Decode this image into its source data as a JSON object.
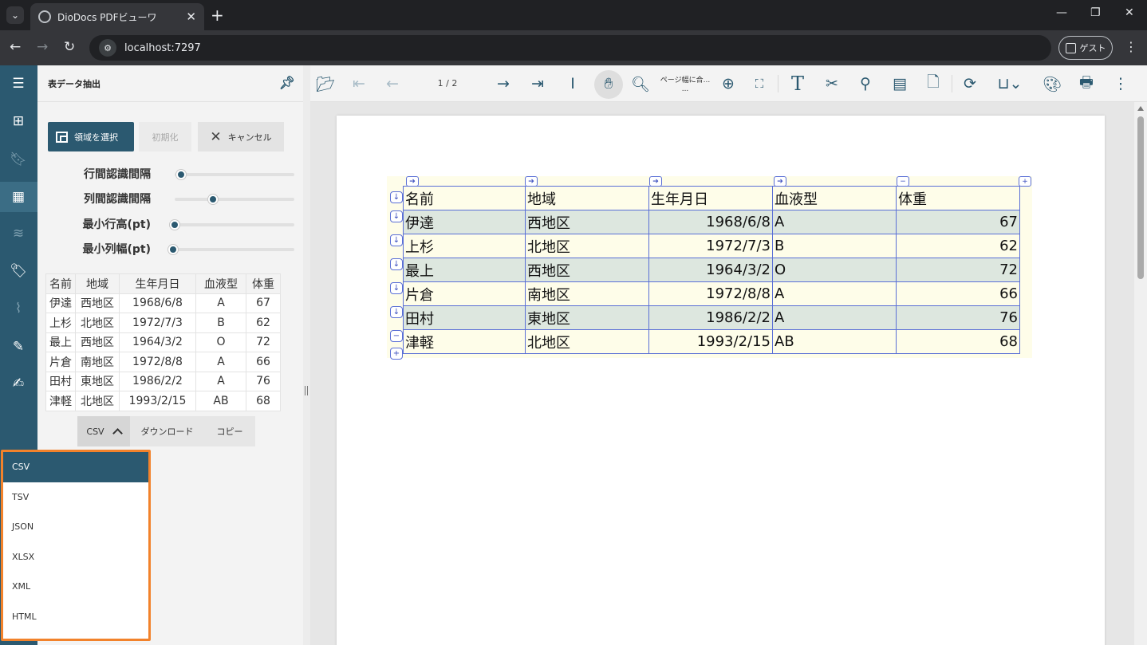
{
  "browser": {
    "tab_title": "DioDocs PDFビューワ",
    "tab_close": "✕",
    "new_tab": "+",
    "url": "localhost:7297",
    "guest_label": "ゲスト"
  },
  "panel": {
    "title": "表データ抽出",
    "select_area_label": "領域を選択",
    "reset_label": "初期化",
    "cancel_label": "キャンセル",
    "sliders": [
      {
        "label": "行間認識間隔",
        "level": 0.07
      },
      {
        "label": "列間認識間隔",
        "level": 0.34
      },
      {
        "label": "最小行高(pt)",
        "level": 0.0
      },
      {
        "label": "最小列幅(pt)",
        "level": 0.0
      }
    ],
    "table": {
      "headers": [
        "名前",
        "地域",
        "生年月日",
        "血液型",
        "体重"
      ],
      "rows": [
        [
          "伊達",
          "西地区",
          "1968/6/8",
          "A",
          "67"
        ],
        [
          "上杉",
          "北地区",
          "1972/7/3",
          "B",
          "62"
        ],
        [
          "最上",
          "西地区",
          "1964/3/2",
          "O",
          "72"
        ],
        [
          "片倉",
          "南地区",
          "1972/8/8",
          "A",
          "66"
        ],
        [
          "田村",
          "東地区",
          "1986/2/2",
          "A",
          "76"
        ],
        [
          "津軽",
          "北地区",
          "1993/2/15",
          "AB",
          "68"
        ]
      ]
    },
    "export": {
      "format_selected": "CSV",
      "download_label": "ダウンロード",
      "copy_label": "コピー",
      "format_options": [
        "CSV",
        "TSV",
        "JSON",
        "XLSX",
        "XML",
        "HTML"
      ]
    }
  },
  "toolbar": {
    "page_indicator": "1 / 2",
    "zoom_label_1": "ページ幅に合...",
    "zoom_label_2": "..."
  },
  "document": {
    "table": {
      "headers": [
        "名前",
        "地域",
        "生年月日",
        "血液型",
        "体重"
      ],
      "rows": [
        [
          "伊達",
          "西地区",
          "1968/6/8",
          "A",
          "67"
        ],
        [
          "上杉",
          "北地区",
          "1972/7/3",
          "B",
          "62"
        ],
        [
          "最上",
          "西地区",
          "1964/3/2",
          "O",
          "72"
        ],
        [
          "片倉",
          "南地区",
          "1972/8/8",
          "A",
          "66"
        ],
        [
          "田村",
          "東地区",
          "1986/2/2",
          "A",
          "76"
        ],
        [
          "津軽",
          "北地区",
          "1993/2/15",
          "AB",
          "68"
        ]
      ]
    }
  },
  "colors": {
    "accent": "#2b5970",
    "highlight_border": "#f2822b",
    "selection_border": "#5a6fd6"
  }
}
